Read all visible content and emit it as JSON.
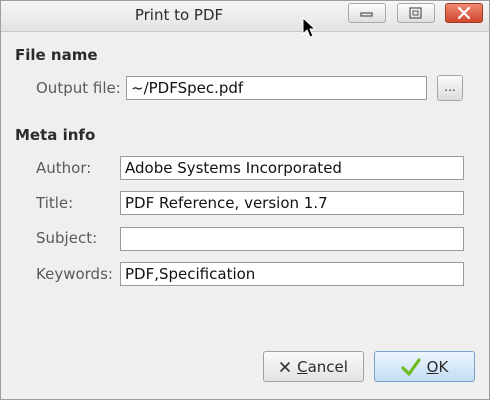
{
  "window": {
    "title": "Print to PDF"
  },
  "file_section": {
    "heading": "File name",
    "output_label": "Output file:",
    "output_value": "~/PDFSpec.pdf",
    "browse_label": "..."
  },
  "meta_section": {
    "heading": "Meta info",
    "author_label": "Author:",
    "author_value": "Adobe Systems Incorporated",
    "title_label": "Title:",
    "title_value": "PDF Reference, version 1.7",
    "subject_label": "Subject:",
    "subject_value": "",
    "keywords_label": "Keywords:",
    "keywords_value": "PDF,Specification"
  },
  "buttons": {
    "cancel_first": "C",
    "cancel_rest": "ancel",
    "ok_first": "O",
    "ok_rest": "K"
  },
  "colors": {
    "ok_check": "#6dbb1f",
    "close_button": "#d0462c"
  },
  "icons": [
    "minimize-icon",
    "maximize-icon",
    "close-icon",
    "cancel-x-icon",
    "checkmark-icon",
    "mouse-cursor-icon"
  ]
}
